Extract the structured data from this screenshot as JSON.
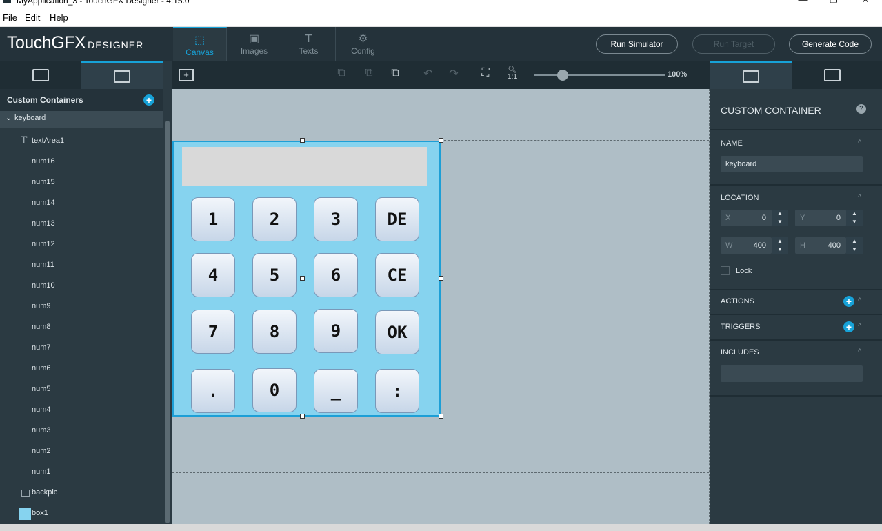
{
  "window": {
    "title": "MyApplication_3 - TouchGFX Designer - 4.15.0",
    "minimize": "—",
    "maximize": "❐",
    "close": "✕"
  },
  "menu": {
    "file": "File",
    "edit": "Edit",
    "help": "Help"
  },
  "logo": {
    "main": "TouchGFX",
    "sub": "DESIGNER"
  },
  "nav": [
    {
      "label": "Canvas",
      "icon": "⬚"
    },
    {
      "label": "Images",
      "icon": "▣"
    },
    {
      "label": "Texts",
      "icon": "T"
    },
    {
      "label": "Config",
      "icon": "⚙"
    }
  ],
  "actions": {
    "run_simulator": "Run Simulator",
    "run_target": "Run Target",
    "generate_code": "Generate Code"
  },
  "left_panel": {
    "title": "Custom Containers",
    "tree": [
      {
        "label": "keyboard"
      },
      {
        "label": "textArea1"
      },
      {
        "label": "num16"
      },
      {
        "label": "num15"
      },
      {
        "label": "num14"
      },
      {
        "label": "num13"
      },
      {
        "label": "num12"
      },
      {
        "label": "num11"
      },
      {
        "label": "num10"
      },
      {
        "label": "num9"
      },
      {
        "label": "num8"
      },
      {
        "label": "num7"
      },
      {
        "label": "num6"
      },
      {
        "label": "num5"
      },
      {
        "label": "num4"
      },
      {
        "label": "num3"
      },
      {
        "label": "num2"
      },
      {
        "label": "num1"
      },
      {
        "label": "backpic"
      },
      {
        "label": "box1"
      }
    ]
  },
  "toolbar": {
    "zoom": "100%",
    "zoom_reset": "1:1",
    "zoom_level": 0.22
  },
  "keyboard": {
    "keys": [
      [
        "1",
        "2",
        "3",
        "DE"
      ],
      [
        "4",
        "5",
        "6",
        "CE"
      ],
      [
        "7",
        "8",
        "9",
        "OK"
      ],
      [
        ".",
        "0",
        "_",
        ":"
      ]
    ]
  },
  "properties": {
    "title": "CUSTOM CONTAINER",
    "help": "?",
    "name_section": "NAME",
    "name_value": "keyboard",
    "location_section": "LOCATION",
    "x_label": "X",
    "x_value": "0",
    "y_label": "Y",
    "y_value": "0",
    "w_label": "W",
    "w_value": "400",
    "h_label": "H",
    "h_value": "400",
    "lock": "Lock",
    "actions_section": "ACTIONS",
    "triggers_section": "TRIGGERS",
    "includes_section": "INCLUDES"
  },
  "colors": {
    "accent": "#17a2d8",
    "container_bg": "#86d3ef",
    "canvas_bg": "#afbec6"
  }
}
